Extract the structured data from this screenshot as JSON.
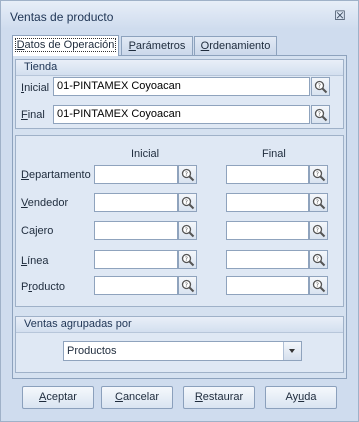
{
  "window": {
    "title": "Ventas de producto",
    "close_glyph": "☒"
  },
  "tabs": [
    {
      "label_pre": "",
      "label_key": "D",
      "label_post": "atos de Operación"
    },
    {
      "label_pre": "",
      "label_key": "P",
      "label_post": "arámetros"
    },
    {
      "label_pre": "",
      "label_key": "O",
      "label_post": "rdenamiento"
    }
  ],
  "tienda": {
    "header": "Tienda",
    "inicial_key": "I",
    "inicial_rest": "nicial",
    "inicial_value": "01-PINTAMEX Coyoacan",
    "final_key": "F",
    "final_rest": "inal",
    "final_value": "01-PINTAMEX Coyoacan"
  },
  "filters": {
    "col_inicial": "Inicial",
    "col_final": "Final",
    "rows": [
      {
        "pre": "",
        "key": "D",
        "post": "epartamento"
      },
      {
        "pre": "",
        "key": "V",
        "post": "endedor"
      },
      {
        "pre": "Ca",
        "key": "j",
        "post": "ero"
      },
      {
        "pre": "",
        "key": "L",
        "post": "ínea"
      },
      {
        "pre": "P",
        "key": "r",
        "post": "oducto"
      }
    ]
  },
  "agrupadas": {
    "header": "Ventas agrupadas por",
    "selected": "Productos"
  },
  "buttons": [
    {
      "key": "A",
      "rest": "ceptar"
    },
    {
      "key": "C",
      "rest": "ancelar"
    },
    {
      "key": "R",
      "rest": "estaurar"
    },
    {
      "pre": "Ay",
      "key": "u",
      "rest": "da"
    }
  ],
  "icons": {
    "lookup": "magnifier-icon"
  }
}
